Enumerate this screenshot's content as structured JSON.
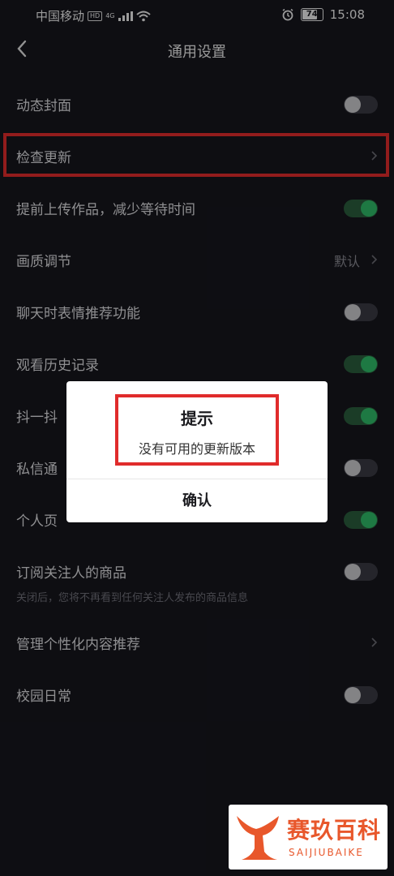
{
  "status": {
    "carrier": "中国移动",
    "hd": "HD",
    "net": "4G",
    "battery": "74",
    "time": "15:08"
  },
  "nav": {
    "title": "通用设置"
  },
  "rows": [
    {
      "label": "动态封面",
      "toggle": "off"
    },
    {
      "label": "检查更新",
      "chevron": true
    },
    {
      "label": "提前上传作品，减少等待时间",
      "toggle": "on"
    },
    {
      "label": "画质调节",
      "value": "默认",
      "chevron": true
    },
    {
      "label": "聊天时表情推荐功能",
      "toggle": "off"
    },
    {
      "label": "观看历史记录",
      "toggle": "on"
    },
    {
      "label": "抖一抖",
      "toggle": "on"
    },
    {
      "label": "私信通",
      "toggle": "off"
    },
    {
      "label": "个人页",
      "toggle": "on"
    },
    {
      "label": "订阅关注人的商品",
      "sub": "关闭后，您将不再看到任何关注人发布的商品信息",
      "toggle": "off"
    },
    {
      "label": "管理个性化内容推荐",
      "chevron": true
    },
    {
      "label": "校园日常",
      "toggle": "off"
    }
  ],
  "dialog": {
    "title": "提示",
    "message": "没有可用的更新版本",
    "confirm": "确认"
  },
  "watermark": {
    "cn": "赛玖百科",
    "en": "SAIJIUBAIKE"
  },
  "colors": {
    "background": "#16161d",
    "toggle_on": "#2fbb68",
    "highlight": "#e02b2b",
    "watermark": "#e8572b"
  }
}
